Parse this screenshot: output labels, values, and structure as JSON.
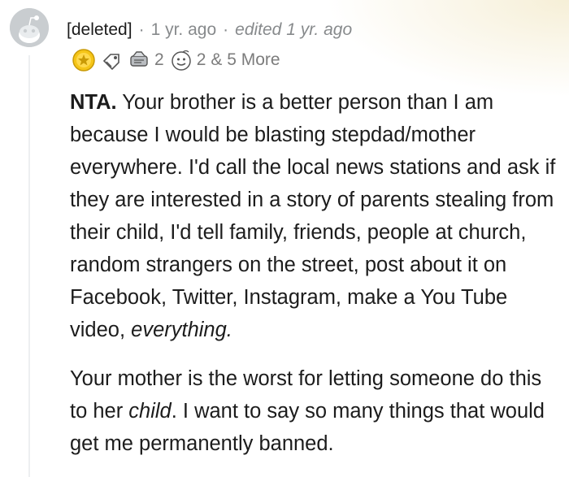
{
  "comment": {
    "author": "[deleted]",
    "separator": "·",
    "age": "1 yr. ago",
    "edited": "edited 1 yr. ago",
    "awards": {
      "icons": [
        "gold-award-icon",
        "silver-award-icon",
        "helpful-award-icon",
        "wholesome-award-icon"
      ],
      "count_a": "2",
      "count_b": "2",
      "more": "& 5 More"
    },
    "body": {
      "p1_bold": "NTA.",
      "p1_text": " Your brother is a better person than I am because I would be blasting stepdad/mother everywhere. I'd call the local news stations and ask if they are interested in a story of parents stealing from their child, I'd tell family, friends, people at church, random strangers on the street, post about it on Facebook, Twitter, Instagram, make a You Tube video, ",
      "p1_italic": "everything.",
      "p2_text_a": "Your mother is the worst for letting someone do this to her ",
      "p2_italic": "child",
      "p2_text_b": ". I want to say so many things that would get me permanently banned."
    }
  },
  "colors": {
    "meta_text": "#878a8c",
    "body_text": "#1c1c1c",
    "thread_line": "#edeff1"
  }
}
